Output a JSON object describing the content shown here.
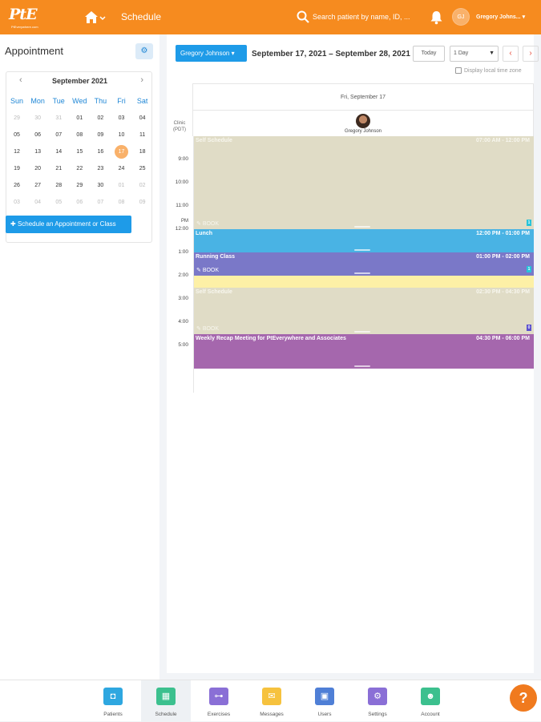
{
  "header": {
    "logo_text": "PtE",
    "logo_subtext": "PtEverywhere.com",
    "breadcrumb": "Schedule",
    "search_placeholder": "Search patient by name, ID, ...",
    "user_initials": "GJ",
    "user_name": "Gregory Johns... ▾",
    "brand_color": "#f68b1f"
  },
  "sidebar": {
    "title": "Appointment",
    "settings_icon": "gear-icon",
    "calendar": {
      "month_label": "September 2021",
      "weekdays": [
        "Sun",
        "Mon",
        "Tue",
        "Wed",
        "Thu",
        "Fri",
        "Sat"
      ],
      "weeks": [
        [
          {
            "d": "29",
            "m": true
          },
          {
            "d": "30",
            "m": true
          },
          {
            "d": "31",
            "m": true
          },
          {
            "d": "01"
          },
          {
            "d": "02"
          },
          {
            "d": "03"
          },
          {
            "d": "04"
          }
        ],
        [
          {
            "d": "05"
          },
          {
            "d": "06"
          },
          {
            "d": "07"
          },
          {
            "d": "08"
          },
          {
            "d": "09"
          },
          {
            "d": "10"
          },
          {
            "d": "11"
          }
        ],
        [
          {
            "d": "12"
          },
          {
            "d": "13"
          },
          {
            "d": "14"
          },
          {
            "d": "15"
          },
          {
            "d": "16"
          },
          {
            "d": "17",
            "sel": true
          },
          {
            "d": "18"
          }
        ],
        [
          {
            "d": "19"
          },
          {
            "d": "20"
          },
          {
            "d": "21"
          },
          {
            "d": "22"
          },
          {
            "d": "23"
          },
          {
            "d": "24"
          },
          {
            "d": "25"
          }
        ],
        [
          {
            "d": "26"
          },
          {
            "d": "27"
          },
          {
            "d": "28"
          },
          {
            "d": "29"
          },
          {
            "d": "30"
          },
          {
            "d": "01",
            "m": true
          },
          {
            "d": "02",
            "m": true
          }
        ],
        [
          {
            "d": "03",
            "m": true
          },
          {
            "d": "04",
            "m": true
          },
          {
            "d": "05",
            "m": true
          },
          {
            "d": "06",
            "m": true
          },
          {
            "d": "07",
            "m": true
          },
          {
            "d": "08",
            "m": true
          },
          {
            "d": "09",
            "m": true
          }
        ]
      ]
    },
    "schedule_button": "Schedule an Appointment or Class"
  },
  "toolbar": {
    "provider": "Gregory Johnson",
    "date_range": "September 17, 2021 – September 28, 2021",
    "today": "Today",
    "view": "1 Day",
    "local_tz": "Display local time zone"
  },
  "day": {
    "title": "Fri, September 17",
    "provider_name": "Gregory Johnson",
    "clinic_label": "Clinic (PDT)",
    "hours": [
      "9:00",
      "10:00",
      "11:00",
      "12:00",
      "1:00",
      "2:00",
      "3:00",
      "4:00",
      "5:00"
    ],
    "pm": "PM",
    "events": [
      {
        "kind": "self",
        "title": "Self Schedule",
        "time": "07:00 AM - 12:00 PM",
        "book": "BOOK",
        "badge": "1"
      },
      {
        "kind": "lunch",
        "title": "Lunch",
        "time": "12:00 PM - 01:00 PM"
      },
      {
        "kind": "run",
        "title": "Running Class",
        "time": "01:00 PM - 02:00 PM",
        "book": "BOOK",
        "badge": "1"
      },
      {
        "kind": "self",
        "title": "Self Schedule",
        "time": "02:30 PM - 04:30 PM",
        "book": "BOOK",
        "badge": "0"
      },
      {
        "kind": "weekly",
        "title": "Weekly Recap Meeting for PtEverywhere and Associates",
        "time": "04:30 PM - 06:00 PM"
      }
    ]
  },
  "bottom_nav": [
    {
      "label": "Patients",
      "icon": "camera-icon",
      "color": "#2ea7e0"
    },
    {
      "label": "Schedule",
      "icon": "calendar-icon",
      "color": "#3cc08e",
      "active": true
    },
    {
      "label": "Exercises",
      "icon": "dumbbell-icon",
      "color": "#8a6fd6"
    },
    {
      "label": "Messages",
      "icon": "envelope-icon",
      "color": "#f6c23e"
    },
    {
      "label": "Users",
      "icon": "user-card-icon",
      "color": "#4f7fd6"
    },
    {
      "label": "Settings",
      "icon": "gear-icon",
      "color": "#8a6fd6"
    },
    {
      "label": "Account",
      "icon": "account-icon",
      "color": "#3cc08e"
    }
  ],
  "help": "?"
}
